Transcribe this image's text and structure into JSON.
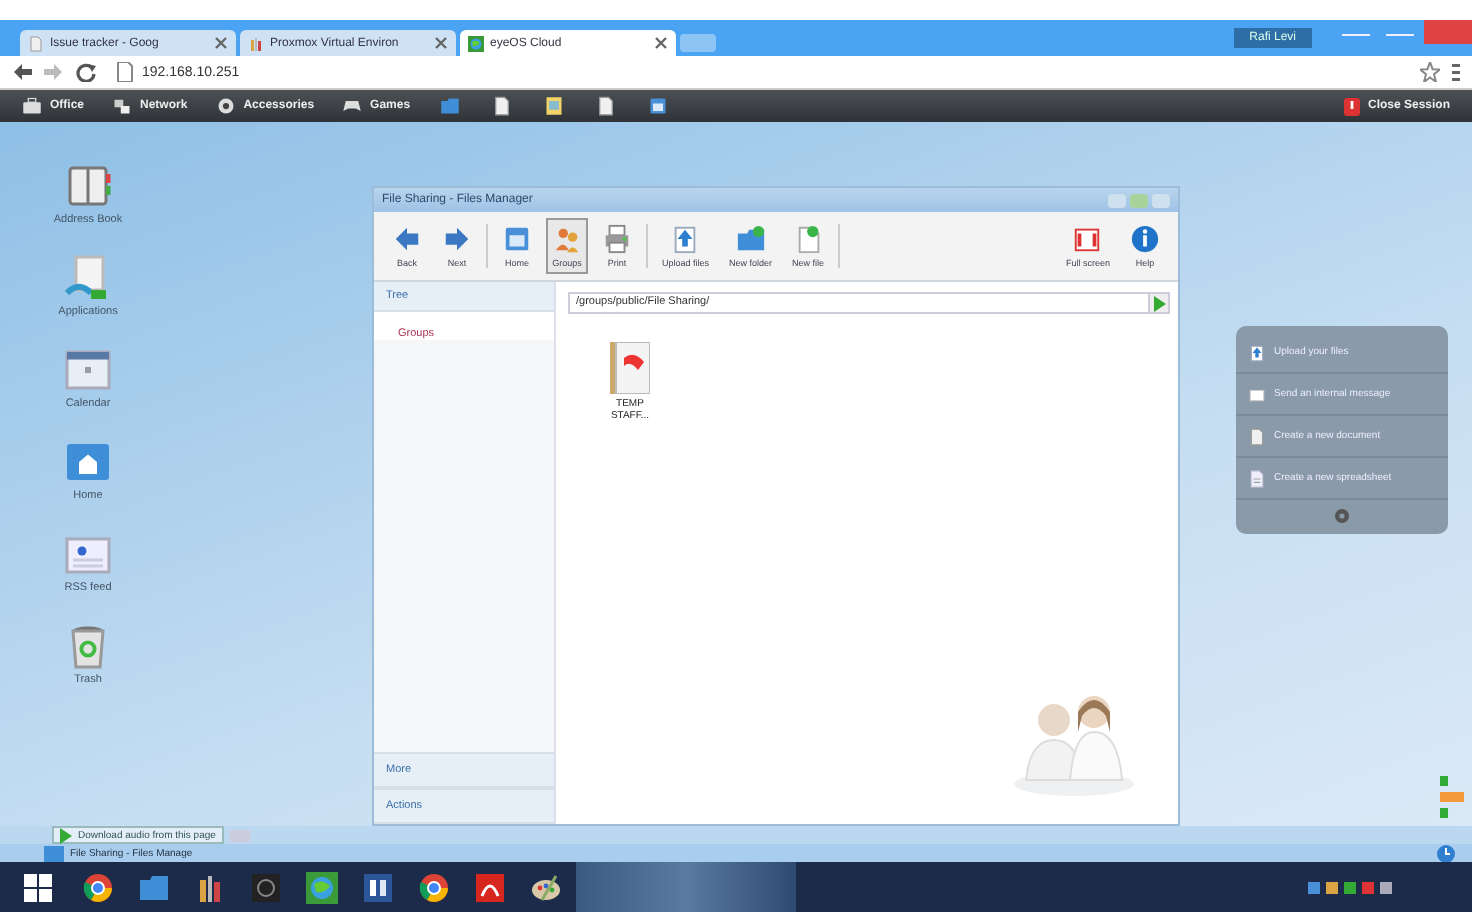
{
  "browser": {
    "tabs": [
      {
        "title": "Issue tracker - Goog",
        "selected": false
      },
      {
        "title": "Proxmox Virtual Environ",
        "selected": false
      },
      {
        "title": "eyeOS Cloud",
        "selected": true
      }
    ],
    "user": "Rafi Levi",
    "url": "192.168.10.251"
  },
  "menubar": {
    "items": [
      {
        "label": "Office",
        "kind": "case"
      },
      {
        "label": "Network",
        "kind": "network"
      },
      {
        "label": "Accessories",
        "kind": "gear"
      },
      {
        "label": "Games",
        "kind": "gamepad"
      }
    ],
    "quick": [
      {
        "kind": "folder"
      },
      {
        "kind": "doc"
      },
      {
        "kind": "picture"
      },
      {
        "kind": "doc"
      },
      {
        "kind": "window"
      }
    ],
    "close": "Close Session"
  },
  "desktop_icons": [
    {
      "label": "Address Book",
      "kind": "book"
    },
    {
      "label": "Applications",
      "kind": "apps"
    },
    {
      "label": "Calendar",
      "kind": "calendar"
    },
    {
      "label": "Home",
      "kind": "home"
    },
    {
      "label": "RSS feed",
      "kind": "rss"
    },
    {
      "label": "Trash",
      "kind": "trash"
    }
  ],
  "window": {
    "title": "File Sharing - Files Manager",
    "toolbar": [
      {
        "label": "Back",
        "kind": "left",
        "selected": false
      },
      {
        "label": "Next",
        "kind": "right",
        "selected": false
      },
      {
        "label": "Home",
        "kind": "window",
        "selected": false
      },
      {
        "label": "Groups",
        "kind": "groups",
        "selected": true
      },
      {
        "label": "Print",
        "kind": "print",
        "selected": false
      },
      {
        "label": "Upload files",
        "kind": "upload",
        "selected": false
      },
      {
        "label": "New folder",
        "kind": "newfolder",
        "selected": false
      },
      {
        "label": "New file",
        "kind": "newfile",
        "selected": false
      },
      {
        "label": "Full screen",
        "kind": "fullscreen",
        "selected": false
      },
      {
        "label": "Help",
        "kind": "help",
        "selected": false
      }
    ],
    "tree_header": "Tree",
    "tree": [
      {
        "label": "Groups"
      }
    ],
    "path": "/groups/public/File Sharing/",
    "files": [
      {
        "name": "TEMP STAFF..."
      }
    ],
    "sections": [
      "More",
      "Actions"
    ]
  },
  "actions_panel": {
    "items": [
      {
        "label": "Upload your files",
        "kind": "upload"
      },
      {
        "label": "Send an internal message",
        "kind": "message"
      },
      {
        "label": "Create a new document",
        "kind": "doc"
      },
      {
        "label": "Create a new spreadsheet",
        "kind": "sheet"
      }
    ]
  },
  "download_bar": "Download audio from this page",
  "status": "File Sharing - Files Manage",
  "taskbar": [
    {
      "kind": "start"
    },
    {
      "kind": "chrome"
    },
    {
      "kind": "folder"
    },
    {
      "kind": "tools"
    },
    {
      "kind": "dark"
    },
    {
      "kind": "globe"
    },
    {
      "kind": "word"
    },
    {
      "kind": "chrome"
    },
    {
      "kind": "pdf"
    },
    {
      "kind": "paint"
    }
  ]
}
